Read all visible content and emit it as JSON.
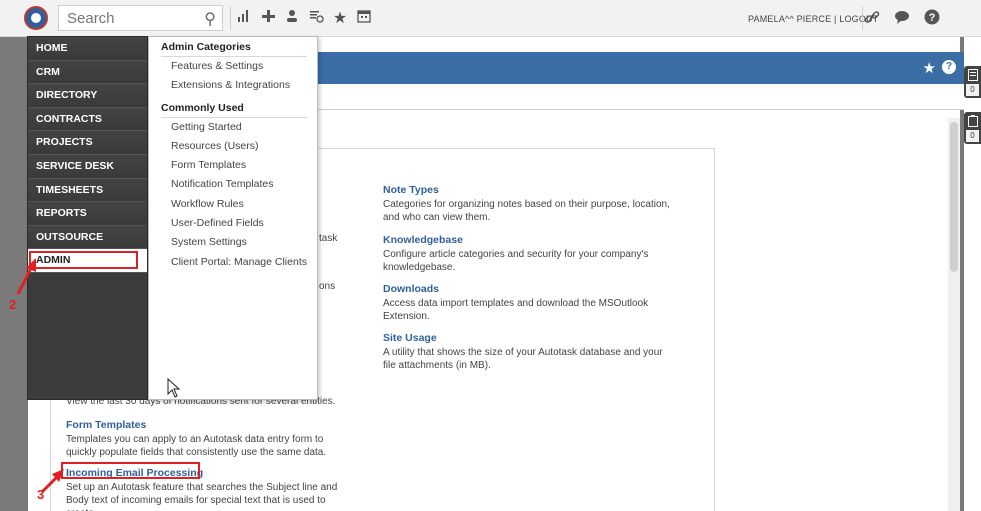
{
  "topbar": {
    "search_placeholder": "Search",
    "user_name": "PAMELA^^ PIERCE",
    "separator": "|",
    "logout": "LOGOUT"
  },
  "menu": {
    "items": [
      {
        "label": "HOME"
      },
      {
        "label": "CRM"
      },
      {
        "label": "DIRECTORY"
      },
      {
        "label": "CONTRACTS"
      },
      {
        "label": "PROJECTS"
      },
      {
        "label": "SERVICE DESK"
      },
      {
        "label": "TIMESHEETS"
      },
      {
        "label": "REPORTS"
      },
      {
        "label": "OUTSOURCE"
      },
      {
        "label": "ADMIN"
      }
    ],
    "active": "ADMIN"
  },
  "submenu": {
    "admin_categories_title": "Admin Categories",
    "admin_categories": [
      {
        "label": "Features & Settings"
      },
      {
        "label": "Extensions & Integrations"
      }
    ],
    "commonly_used_title": "Commonly Used",
    "commonly_used": [
      {
        "label": "Getting Started"
      },
      {
        "label": "Resources (Users)"
      },
      {
        "label": "Form Templates"
      },
      {
        "label": "Notification Templates"
      },
      {
        "label": "Workflow Rules"
      },
      {
        "label": "User-Defined Fields"
      },
      {
        "label": "System Settings"
      },
      {
        "label": "Client Portal: Manage Clients"
      }
    ]
  },
  "content": {
    "right": [
      {
        "title": "Note Types",
        "desc": "Categories for organizing notes based on their purpose, location, and who can view them."
      },
      {
        "title": "Knowledgebase",
        "desc": "Configure article categories and security for your company's knowledgebase."
      },
      {
        "title": "Downloads",
        "desc": "Access data import templates and download the MSOutlook Extension."
      },
      {
        "title": "Site Usage",
        "desc": "A utility that shows the size of your Autotask database and your file attachments (in MB)."
      }
    ],
    "left": [
      {
        "title": "Form Templates",
        "desc": "Templates you can apply to an Autotask data entry form to quickly populate fields that consistently use the same data."
      },
      {
        "title": "Incoming Email Processing",
        "desc": "Set up an Autotask feature that searches the Subject line and Body text of incoming emails for special text that is used to create"
      }
    ],
    "partial_1": "task",
    "partial_2": "ons",
    "partial_3": "View the last 30 days of notifications sent for several entities."
  },
  "side_widgets": [
    {
      "count": "0"
    },
    {
      "count": "0"
    }
  ],
  "annotations": {
    "step2": "2",
    "step3": "3",
    "color": "#e02020"
  },
  "colors": {
    "header_blue": "#3b6ea5",
    "menu_dark": "#3c3c3c",
    "link_blue": "#2f5f9c"
  }
}
